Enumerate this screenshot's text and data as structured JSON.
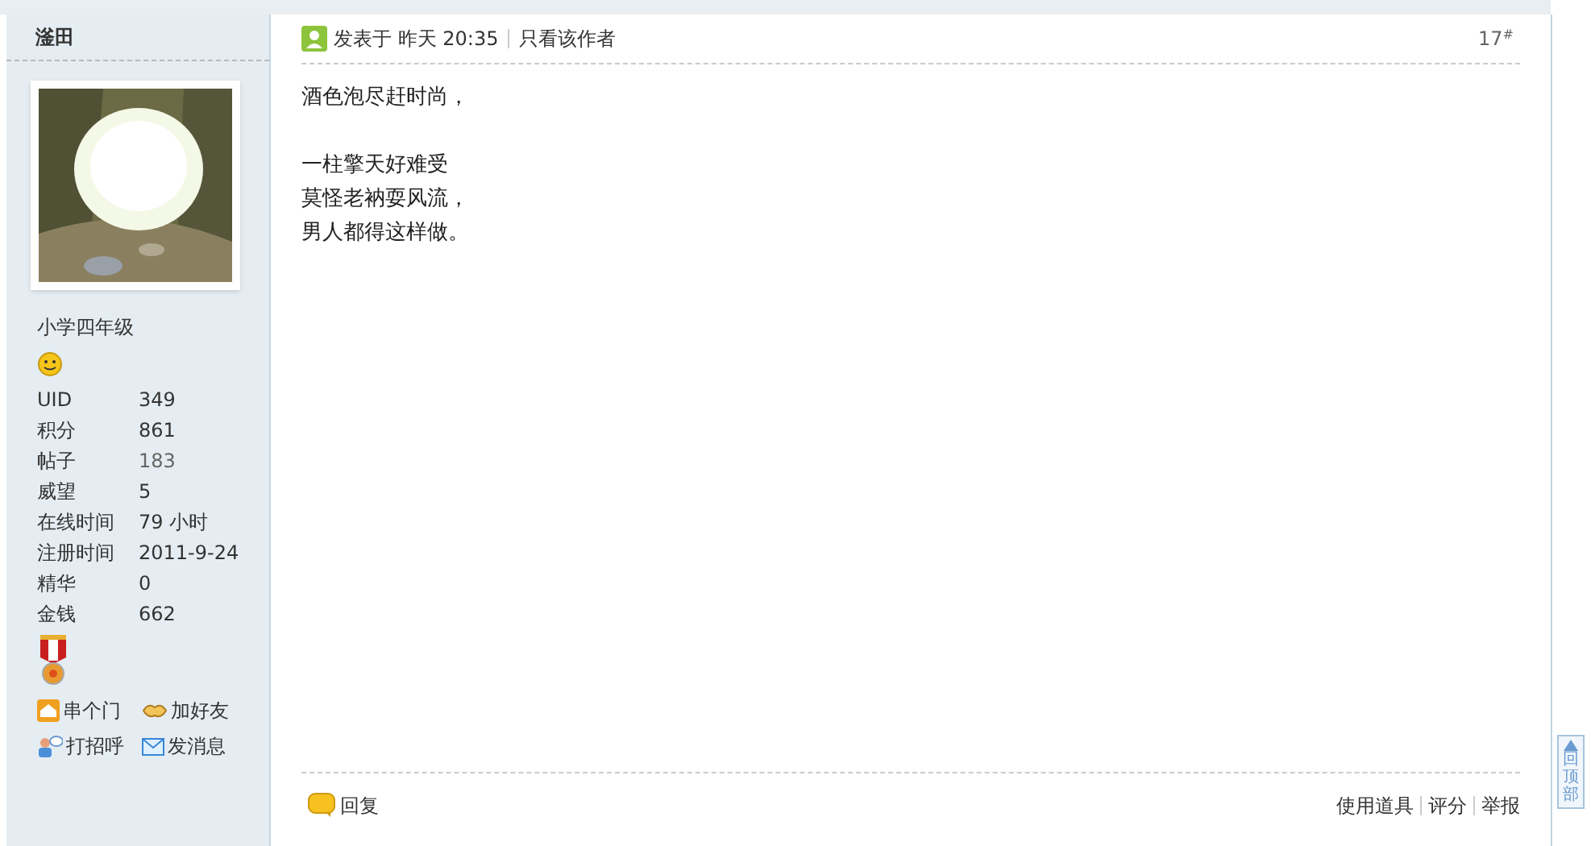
{
  "author": {
    "name": "滏田",
    "rank": "小学四年级"
  },
  "profile_stats": [
    {
      "label": "UID",
      "value": "349",
      "kind": "plain"
    },
    {
      "label": "积分",
      "value": "861",
      "kind": "plain"
    },
    {
      "label": "帖子",
      "value": "183",
      "kind": "link"
    },
    {
      "label": "威望",
      "value": "5",
      "kind": "plain"
    },
    {
      "label": "在线时间",
      "value": "79 小时",
      "kind": "plain"
    },
    {
      "label": "注册时间",
      "value": "2011-9-24",
      "kind": "plain"
    },
    {
      "label": "精华",
      "value": "0",
      "kind": "plain"
    },
    {
      "label": "金钱",
      "value": "662",
      "kind": "plain"
    }
  ],
  "profile_actions": [
    {
      "label": "串个门",
      "kind": "home"
    },
    {
      "label": "加好友",
      "kind": "friend"
    },
    {
      "label": "打招呼",
      "kind": "greet"
    },
    {
      "label": "发消息",
      "kind": "message"
    }
  ],
  "post": {
    "posted_label": "发表于",
    "time": "昨天 20:35",
    "author_only_link": "只看该作者",
    "floor": "17",
    "floor_mark": "#",
    "paragraphs": [
      [
        "酒色泡尽赶时尚，"
      ],
      [
        "一柱擎天好难受",
        "莫怪老衲耍风流，",
        "男人都得这样做。"
      ]
    ]
  },
  "footer": {
    "reply": "回复",
    "tools": [
      "使用道具",
      "评分",
      "举报"
    ]
  },
  "back_to_top": "回顶部"
}
